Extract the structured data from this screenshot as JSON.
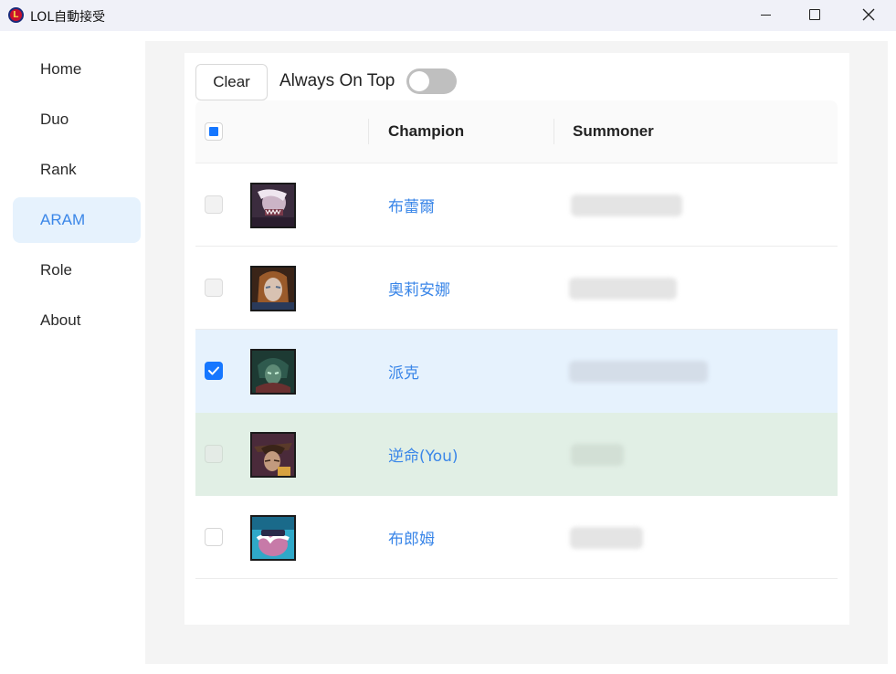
{
  "window": {
    "title": "LOL自動接受",
    "logo_letter": "L",
    "logo_icon": "lol-logo-icon",
    "controls": [
      "minimize-icon",
      "maximize-icon",
      "close-icon"
    ]
  },
  "sidebar": {
    "items": [
      {
        "label": "Home",
        "active": false
      },
      {
        "label": "Duo",
        "active": false
      },
      {
        "label": "Rank",
        "active": false
      },
      {
        "label": "ARAM",
        "active": true
      },
      {
        "label": "Role",
        "active": false
      },
      {
        "label": "About",
        "active": false
      }
    ]
  },
  "toolbar": {
    "clear_label": "Clear",
    "always_on_top_label": "Always On Top",
    "always_on_top_enabled": false
  },
  "table": {
    "select_all_state": "indeterminate",
    "columns": [
      "Champion",
      "Summoner"
    ],
    "rows": [
      {
        "champion": "布蕾爾",
        "portrait_icon": "champion-portrait-icon",
        "checked": false,
        "disabled": true,
        "summoner_hidden": true
      },
      {
        "champion": "奧莉安娜",
        "portrait_icon": "champion-portrait-icon",
        "checked": false,
        "disabled": true,
        "summoner_hidden": true
      },
      {
        "champion": "派克",
        "portrait_icon": "champion-portrait-icon",
        "checked": true,
        "disabled": false,
        "summoner_hidden": true
      },
      {
        "champion": "逆命(You)",
        "portrait_icon": "champion-portrait-icon",
        "checked": false,
        "disabled": true,
        "summoner_hidden": true
      },
      {
        "champion": "布郎姆",
        "portrait_icon": "champion-portrait-icon",
        "checked": false,
        "disabled": false,
        "summoner_hidden": true
      }
    ]
  },
  "colors": {
    "accent": "#3a86e8",
    "primary": "#1677ff",
    "selected_row": "#e6f2fd",
    "self_row": "#e1efe5"
  }
}
